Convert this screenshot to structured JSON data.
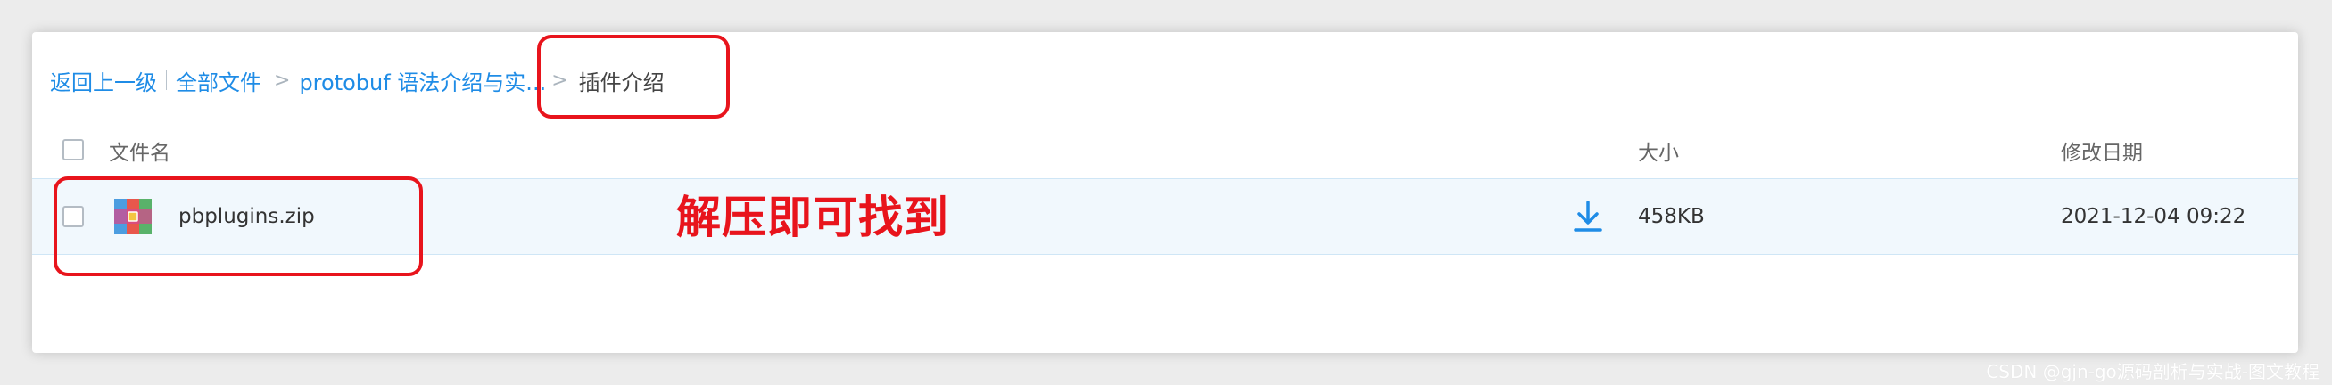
{
  "breadcrumb": {
    "back_label": "返回上一级",
    "all_files_label": "全部文件",
    "parent_folder_label": "protobuf 语法介绍与实...",
    "separator": ">",
    "current_folder_label": "插件介绍"
  },
  "table": {
    "columns": {
      "name": "文件名",
      "size": "大小",
      "modified": "修改日期"
    },
    "rows": [
      {
        "name": "pbplugins.zip",
        "size": "458KB",
        "modified": "2021-12-04 09:22",
        "icon": "zip-archive-icon"
      }
    ]
  },
  "annotation": {
    "text": "解压即可找到",
    "color": "#e8141c"
  },
  "watermark": "CSDN @gjn-go源码剖析与实战-图文教程",
  "colors": {
    "link": "#1f8ce6",
    "row_highlight": "#f1f8fd",
    "annotation_red": "#e8141c"
  }
}
